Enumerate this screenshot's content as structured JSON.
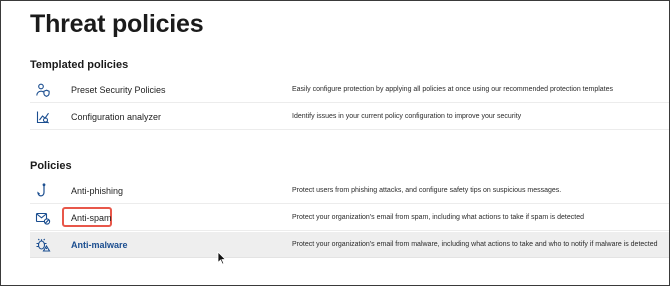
{
  "page": {
    "title": "Threat policies"
  },
  "templated": {
    "section_title": "Templated policies",
    "items": [
      {
        "name": "Preset Security Policies",
        "icon": "user-shield-icon",
        "description": "Easily configure protection by applying all policies at once using our recommended protection templates"
      },
      {
        "name": "Configuration analyzer",
        "icon": "analyzer-icon",
        "description": "Identify issues in your current policy configuration to improve your security"
      }
    ]
  },
  "policies": {
    "section_title": "Policies",
    "items": [
      {
        "name": "Anti-phishing",
        "icon": "fishhook-icon",
        "description": "Protect users from phishing attacks, and configure safety tips on suspicious messages."
      },
      {
        "name": "Anti-spam",
        "icon": "mail-block-icon",
        "description": "Protect your organization's email from spam, including what actions to take if spam is detected"
      },
      {
        "name": "Anti-malware",
        "icon": "malware-bug-icon",
        "description": "Protect your organization's email from malware, including what actions to take and who to notify if malware is detected"
      }
    ]
  },
  "colors": {
    "accent": "#1a4d8f",
    "highlight_box": "#e8574a",
    "row_hover": "#eeeeee"
  }
}
